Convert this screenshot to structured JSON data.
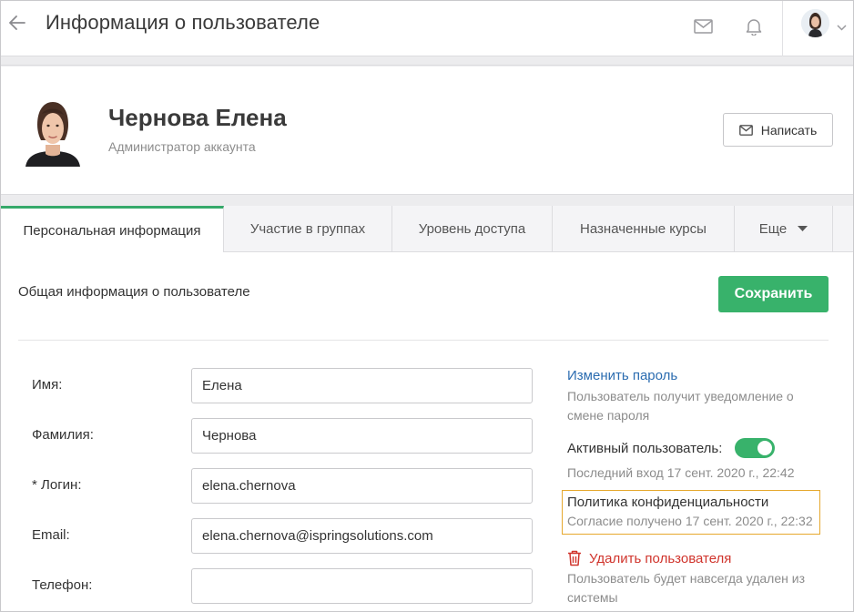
{
  "header": {
    "title": "Информация о пользователе",
    "icons": [
      "back-arrow-icon",
      "mail-icon",
      "bell-icon",
      "chevron-down-icon"
    ]
  },
  "profile": {
    "name": "Чернова Елена",
    "role": "Администратор аккаунта",
    "write_label": "Написать"
  },
  "tabs": [
    {
      "label": "Персональная информация",
      "active": true
    },
    {
      "label": "Участие в группах",
      "active": false
    },
    {
      "label": "Уровень доступа",
      "active": false
    },
    {
      "label": "Назначенные курсы",
      "active": false
    },
    {
      "label": "Еще",
      "active": false
    }
  ],
  "section": {
    "title": "Общая информация о пользователе",
    "save_label": "Сохранить"
  },
  "fields": [
    {
      "label": "Имя:",
      "value": "Елена"
    },
    {
      "label": "Фамилия:",
      "value": "Чернова"
    },
    {
      "label": "* Логин:",
      "value": "elena.chernova"
    },
    {
      "label": "Email:",
      "value": "elena.chernova@ispringsolutions.com"
    },
    {
      "label": "Телефон:",
      "value": ""
    }
  ],
  "sidebar": {
    "change_password": "Изменить пароль",
    "change_password_hint": "Пользователь получит уведомление о смене пароля",
    "active_label": "Активный пользователь:",
    "active_on": true,
    "last_login": "Последний вход 17 сент. 2020 г., 22:42",
    "privacy_title": "Политика конфиденциальности",
    "privacy_consent": "Согласие получено 17 сент. 2020 г., 22:32",
    "delete_label": "Удалить пользователя",
    "delete_hint": "Пользователь будет навсегда удален из системы"
  },
  "colors": {
    "accent_green": "#38b26b",
    "link_blue": "#2b6cb0",
    "danger_red": "#d0342c",
    "highlight_orange": "#e6a82e"
  }
}
